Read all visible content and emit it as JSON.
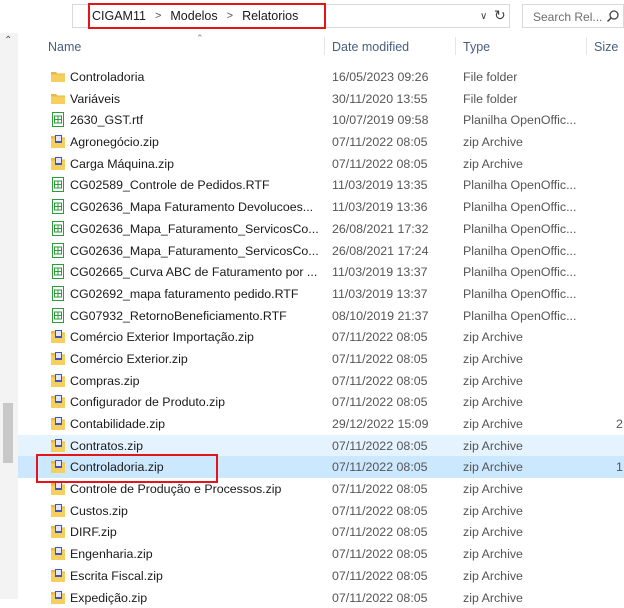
{
  "address_bar": {
    "breadcrumbs": [
      "CIGAM11",
      "Modelos",
      "Relatorios"
    ],
    "separator": ">"
  },
  "search": {
    "placeholder": "Search Rel..."
  },
  "columns": {
    "name": "Name",
    "date": "Date modified",
    "type": "Type",
    "size": "Size"
  },
  "colors": {
    "highlight": "#e4141b",
    "selected_row": "#cce8ff",
    "hover_row": "#e5f3ff",
    "header_text": "#4a5d7e"
  },
  "files": [
    {
      "name": "Controladoria",
      "date": "16/05/2023 09:26",
      "type": "File folder",
      "size": "",
      "icon": "folder"
    },
    {
      "name": "Variáveis",
      "date": "30/11/2020 13:55",
      "type": "File folder",
      "size": "",
      "icon": "folder"
    },
    {
      "name": "2630_GST.rtf",
      "date": "10/07/2019 09:58",
      "type": "Planilha OpenOffic...",
      "size": "",
      "icon": "sheet"
    },
    {
      "name": "Agronegócio.zip",
      "date": "07/11/2022 08:05",
      "type": "zip Archive",
      "size": "",
      "icon": "zip"
    },
    {
      "name": "Carga Máquina.zip",
      "date": "07/11/2022 08:05",
      "type": "zip Archive",
      "size": "",
      "icon": "zip"
    },
    {
      "name": "CG02589_Controle de Pedidos.RTF",
      "date": "11/03/2019 13:35",
      "type": "Planilha OpenOffic...",
      "size": "",
      "icon": "sheet"
    },
    {
      "name": "CG02636_Mapa Faturamento Devolucoes...",
      "date": "11/03/2019 13:36",
      "type": "Planilha OpenOffic...",
      "size": "",
      "icon": "sheet"
    },
    {
      "name": "CG02636_Mapa_Faturamento_ServicosCo...",
      "date": "26/08/2021 17:32",
      "type": "Planilha OpenOffic...",
      "size": "",
      "icon": "sheet"
    },
    {
      "name": "CG02636_Mapa_Faturamento_ServicosCo...",
      "date": "26/08/2021 17:24",
      "type": "Planilha OpenOffic...",
      "size": "",
      "icon": "sheet"
    },
    {
      "name": "CG02665_Curva ABC de Faturamento por ...",
      "date": "11/03/2019 13:37",
      "type": "Planilha OpenOffic...",
      "size": "",
      "icon": "sheet"
    },
    {
      "name": "CG02692_mapa faturamento pedido.RTF",
      "date": "11/03/2019 13:37",
      "type": "Planilha OpenOffic...",
      "size": "",
      "icon": "sheet"
    },
    {
      "name": "CG07932_RetornoBeneficiamento.RTF",
      "date": "08/10/2019 21:37",
      "type": "Planilha OpenOffic...",
      "size": "",
      "icon": "sheet"
    },
    {
      "name": "Comércio Exterior Importação.zip",
      "date": "07/11/2022 08:05",
      "type": "zip Archive",
      "size": "",
      "icon": "zip"
    },
    {
      "name": "Comércio Exterior.zip",
      "date": "07/11/2022 08:05",
      "type": "zip Archive",
      "size": "",
      "icon": "zip"
    },
    {
      "name": "Compras.zip",
      "date": "07/11/2022 08:05",
      "type": "zip Archive",
      "size": "",
      "icon": "zip"
    },
    {
      "name": "Configurador de Produto.zip",
      "date": "07/11/2022 08:05",
      "type": "zip Archive",
      "size": "",
      "icon": "zip"
    },
    {
      "name": "Contabilidade.zip",
      "date": "29/12/2022 15:09",
      "type": "zip Archive",
      "size": "2",
      "icon": "zip"
    },
    {
      "name": "Contratos.zip",
      "date": "07/11/2022 08:05",
      "type": "zip Archive",
      "size": "",
      "icon": "zip",
      "state": "hover"
    },
    {
      "name": "Controladoria.zip",
      "date": "07/11/2022 08:05",
      "type": "zip Archive",
      "size": "1",
      "icon": "zip",
      "state": "selected"
    },
    {
      "name": "Controle de Produção e Processos.zip",
      "date": "07/11/2022 08:05",
      "type": "zip Archive",
      "size": "",
      "icon": "zip"
    },
    {
      "name": "Custos.zip",
      "date": "07/11/2022 08:05",
      "type": "zip Archive",
      "size": "",
      "icon": "zip"
    },
    {
      "name": "DIRF.zip",
      "date": "07/11/2022 08:05",
      "type": "zip Archive",
      "size": "",
      "icon": "zip"
    },
    {
      "name": "Engenharia.zip",
      "date": "07/11/2022 08:05",
      "type": "zip Archive",
      "size": "",
      "icon": "zip"
    },
    {
      "name": "Escrita Fiscal.zip",
      "date": "07/11/2022 08:05",
      "type": "zip Archive",
      "size": "",
      "icon": "zip"
    },
    {
      "name": "Expedição.zip",
      "date": "07/11/2022 08:05",
      "type": "zip Archive",
      "size": "",
      "icon": "zip"
    }
  ]
}
